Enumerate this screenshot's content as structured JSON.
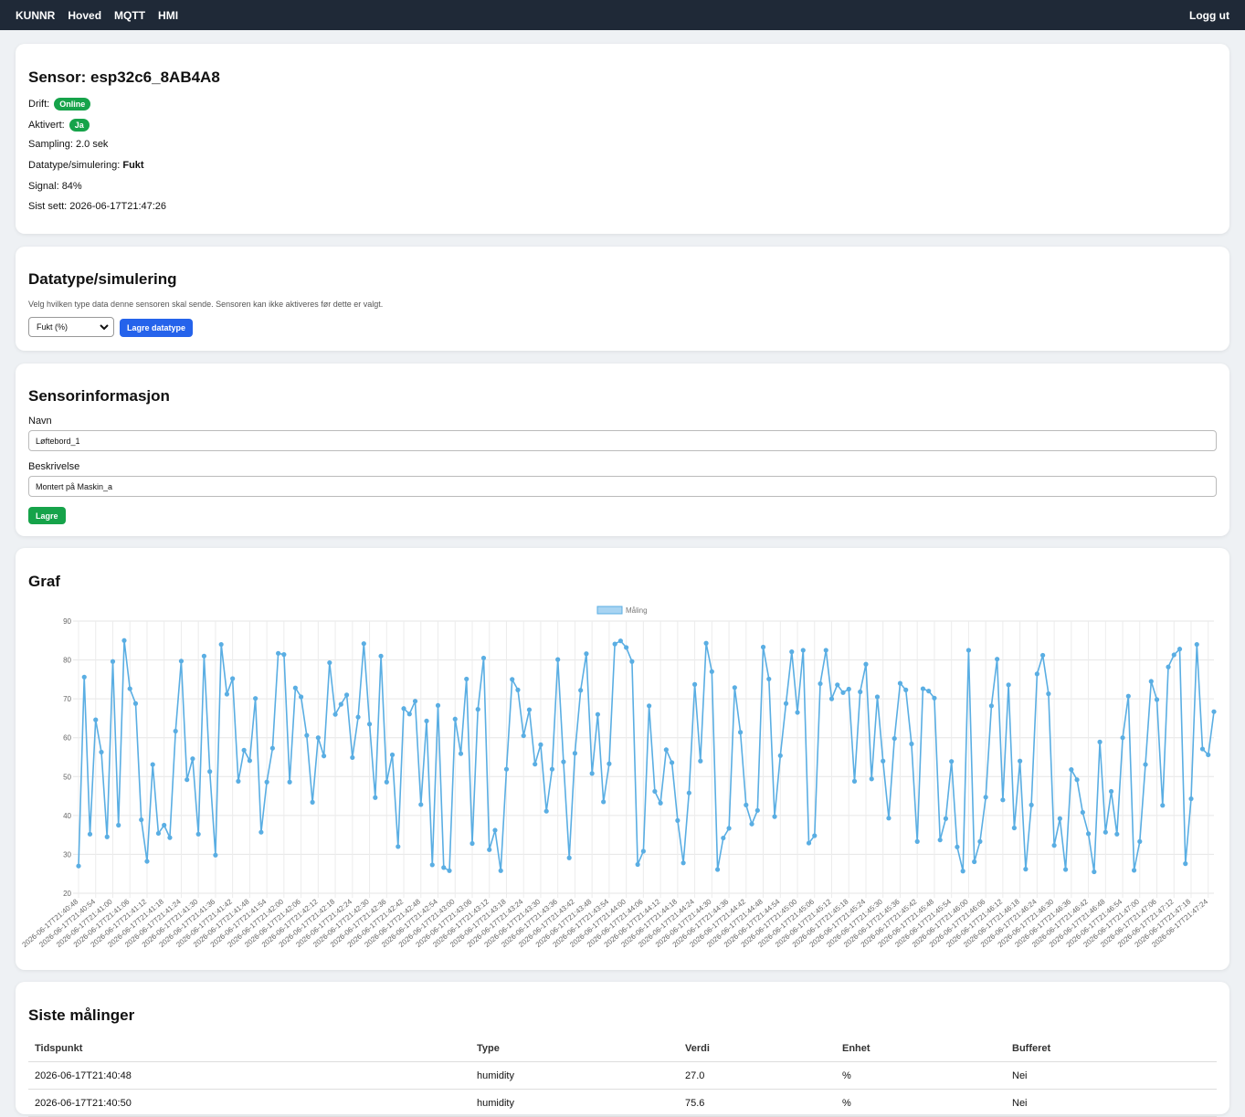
{
  "nav": {
    "brand": "KUNNR",
    "links": [
      "Hoved",
      "MQTT",
      "HMI"
    ],
    "logout": "Logg ut"
  },
  "sensor": {
    "title": "Sensor: esp32c6_8AB4A8",
    "drift_label": "Drift:",
    "drift_badge": "Online",
    "aktivert_label": "Aktivert:",
    "aktivert_badge": "Ja",
    "sampling": "Sampling: 2.0 sek",
    "datatype_label": "Datatype/simulering:",
    "datatype_value": "Fukt",
    "signal": "Signal: 84%",
    "sist_sett": "Sist sett: 2026-06-17T21:47:26",
    "badge_color": "#16a34a"
  },
  "datatype": {
    "title": "Datatype/simulering",
    "help": "Velg hvilken type data denne sensoren skal sende. Sensoren kan ikke aktiveres før dette er valgt.",
    "selected": "Fukt (%)",
    "save_button": "Lagre datatype",
    "button_color": "#2563eb"
  },
  "info": {
    "title": "Sensorinformasjon",
    "name_label": "Navn",
    "name_value": "Løftebord_1",
    "desc_label": "Beskrivelse",
    "desc_value": "Montert på Maskin_a",
    "save_button": "Lagre"
  },
  "graph": {
    "title": "Graf"
  },
  "chart_data": {
    "type": "line",
    "legend": "Måling",
    "legend_position": "top",
    "ylim": [
      20,
      90
    ],
    "yticks": [
      20,
      30,
      40,
      50,
      60,
      70,
      80,
      90
    ],
    "grid": true,
    "color": "#5aaee3",
    "x_start": "2026-06-17T21:40:48",
    "x_step_seconds": 2,
    "x_label_every": 3,
    "values": [
      27.0,
      75.6,
      35.2,
      64.6,
      56.3,
      34.5,
      79.6,
      37.5,
      85.0,
      72.6,
      68.8,
      38.9,
      28.2,
      53.1,
      35.4,
      37.5,
      34.3,
      61.7,
      79.7,
      49.2,
      54.6,
      35.2,
      81.0,
      51.3,
      29.8,
      84.0,
      71.2,
      75.2,
      48.8,
      56.8,
      54.1,
      70.1,
      35.7,
      48.6,
      57.3,
      81.7,
      81.4,
      48.6,
      72.8,
      70.5,
      60.6,
      43.4,
      60.0,
      55.3,
      79.3,
      66.0,
      68.6,
      71.0,
      54.9,
      65.3,
      84.2,
      63.5,
      44.6,
      81.0,
      48.6,
      55.6,
      32.0,
      67.5,
      66.1,
      69.4,
      42.8,
      64.3,
      27.3,
      68.3,
      26.6,
      25.8,
      64.8,
      55.9,
      75.1,
      32.8,
      67.3,
      80.5,
      31.2,
      36.2,
      25.8,
      51.9,
      75.0,
      72.3,
      60.5,
      67.2,
      53.2,
      58.2,
      41.1,
      51.9,
      80.1,
      53.8,
      29.1,
      56.0,
      72.2,
      81.6,
      50.8,
      66.0,
      43.5,
      53.3,
      84.1,
      84.9,
      83.2,
      79.6,
      27.4,
      30.8,
      68.2,
      46.2,
      43.2,
      56.9,
      53.6,
      38.7,
      27.8,
      45.8,
      73.7,
      54.0,
      84.3,
      77.0,
      26.1,
      34.2,
      36.7,
      72.9,
      61.4,
      42.7,
      37.8,
      41.3,
      83.3,
      75.1,
      39.7,
      55.4,
      68.8,
      82.1,
      66.5,
      82.5,
      32.9,
      34.8,
      73.9,
      82.5,
      70.0,
      73.6,
      71.6,
      72.5,
      48.8,
      71.8,
      78.9,
      49.4,
      70.5,
      54.0,
      39.3,
      59.8,
      74.0,
      72.3,
      58.4,
      33.3,
      72.6,
      72.0,
      70.2,
      33.7,
      39.2,
      53.9,
      31.9,
      25.7,
      82.5,
      28.1,
      33.3,
      44.7,
      68.2,
      80.2,
      44.0,
      73.6,
      36.8,
      54.0,
      26.2,
      42.7,
      76.4,
      81.2,
      71.3,
      32.3,
      39.2,
      26.1,
      51.8,
      49.2,
      40.8,
      35.3,
      25.5,
      58.9,
      35.7,
      46.2,
      35.2,
      60.0,
      70.7,
      25.9,
      33.3,
      53.1,
      74.5,
      69.8,
      42.6,
      78.2,
      81.3,
      82.8,
      27.6,
      44.3,
      84.0,
      57.1,
      55.6,
      66.7
    ]
  },
  "table": {
    "title": "Siste målinger",
    "headers": [
      "Tidspunkt",
      "Type",
      "Verdi",
      "Enhet",
      "Bufferet"
    ],
    "rows": [
      [
        "2026-06-17T21:40:48",
        "humidity",
        "27.0",
        "%",
        "Nei"
      ],
      [
        "2026-06-17T21:40:50",
        "humidity",
        "75.6",
        "%",
        "Nei"
      ]
    ]
  }
}
